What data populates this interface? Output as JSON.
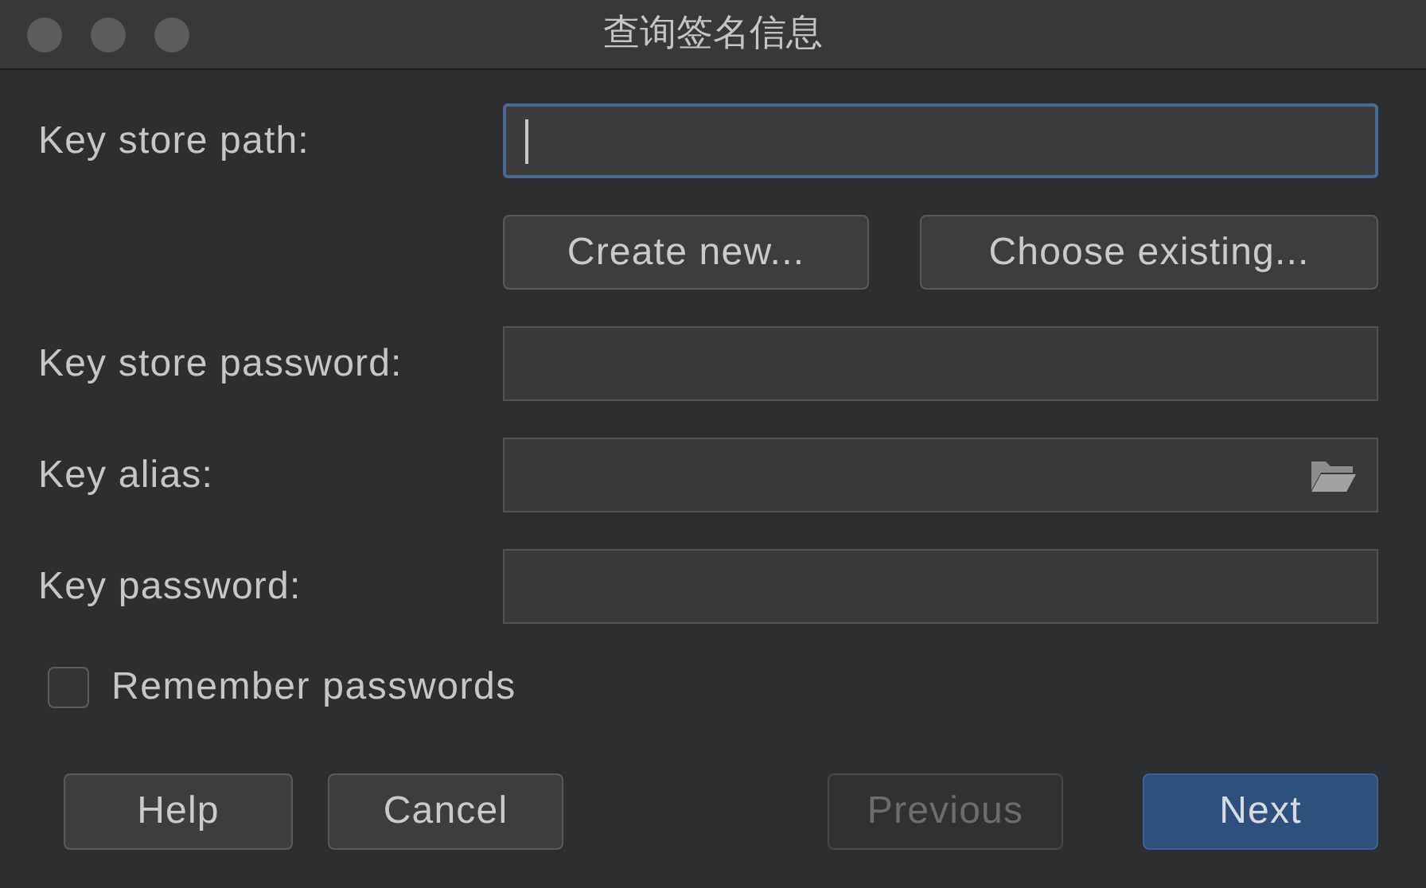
{
  "window": {
    "title": "查询签名信息"
  },
  "fields": [
    {
      "label": "Key store path:",
      "focused": true,
      "kind": "text"
    },
    {
      "label": "Key store password:",
      "focused": false,
      "kind": "text"
    },
    {
      "label": "Key alias:",
      "focused": false,
      "kind": "browse"
    },
    {
      "label": "Key password:",
      "focused": false,
      "kind": "text"
    }
  ],
  "keystore_buttons": [
    "Create new...",
    "Choose existing..."
  ],
  "checkbox": {
    "label": "Remember passwords",
    "checked": false
  },
  "footer_buttons": [
    {
      "label": "Help",
      "disabled": false,
      "default": false
    },
    {
      "label": "Cancel",
      "disabled": false,
      "default": false
    },
    {
      "label": "Previous",
      "disabled": true,
      "default": false
    },
    {
      "label": "Next",
      "disabled": false,
      "default": true
    }
  ]
}
